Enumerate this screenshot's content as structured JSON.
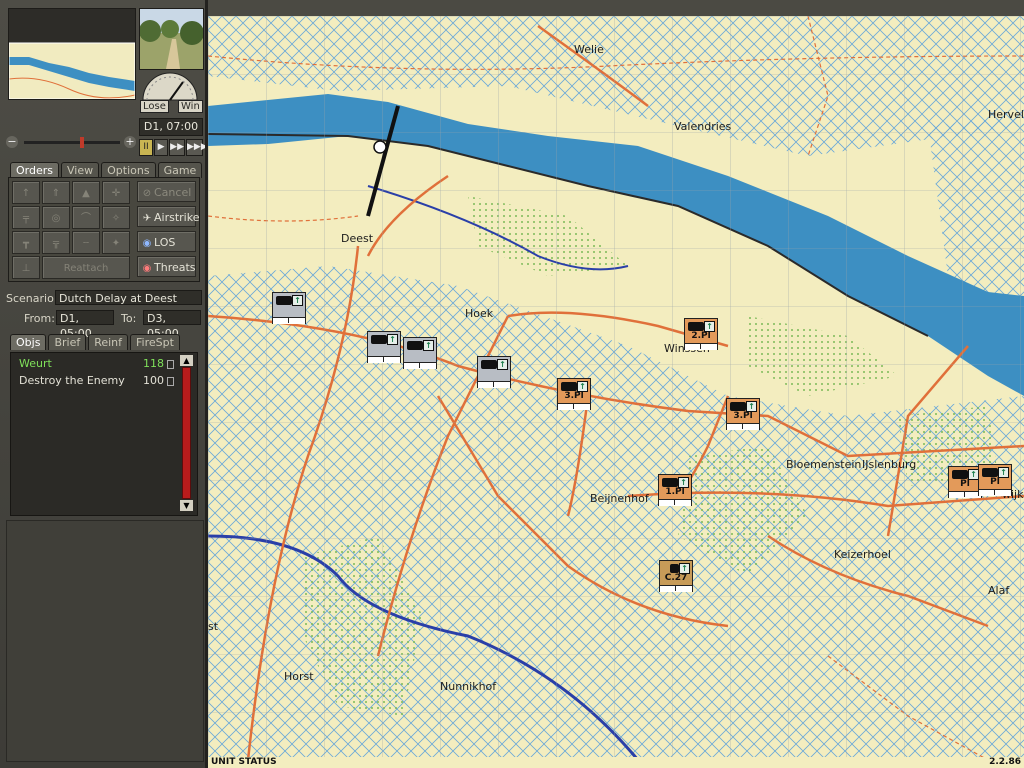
{
  "sidebar": {
    "gauge": {
      "lose_label": "Lose",
      "win_label": "Win"
    },
    "datetime": "D1, 07:00",
    "zoom": {
      "minus": "−",
      "plus": "+"
    },
    "playback": [
      "II",
      "▶",
      "▶▶",
      "▶▶▶"
    ],
    "main_tabs": [
      "Orders",
      "View",
      "Options",
      "Game"
    ],
    "orders": {
      "reattach_label": "Reattach",
      "cancel_label": "Cancel",
      "airstrike_label": "Airstrike",
      "los_label": "LOS",
      "threats_label": "Threats"
    },
    "scenario": {
      "label": "Scenario:",
      "name": "Dutch Delay at Deest",
      "from_label": "From:",
      "from_value": "D1, 05:00",
      "to_label": "To:",
      "to_value": "D3, 05:00"
    },
    "info_tabs": [
      "Objs",
      "Brief",
      "Reinf",
      "FireSpt"
    ],
    "objectives": [
      {
        "name": "Weurt",
        "value": "118"
      },
      {
        "name": "Destroy the Enemy",
        "value": "100"
      }
    ]
  },
  "map": {
    "places": [
      {
        "name": "Welie"
      },
      {
        "name": "Valendries"
      },
      {
        "name": "Herveld"
      },
      {
        "name": "Deest"
      },
      {
        "name": "Hoek"
      },
      {
        "name": "Winssen"
      },
      {
        "name": "Bloemenstein"
      },
      {
        "name": "IJslenburg"
      },
      {
        "name": "Beijnenhof"
      },
      {
        "name": "Keizerhoel"
      },
      {
        "name": "Alaf"
      },
      {
        "name": "Horst"
      },
      {
        "name": "Nunnikhof"
      },
      {
        "name": "st"
      },
      {
        "name": "wijk"
      }
    ],
    "units": [
      {
        "side": "enemy",
        "label": ""
      },
      {
        "side": "enemy",
        "label": ""
      },
      {
        "side": "enemy",
        "label": ""
      },
      {
        "side": "enemy",
        "label": ""
      },
      {
        "side": "allied",
        "label": "2.Pl"
      },
      {
        "side": "allied",
        "label": "3.Pl"
      },
      {
        "side": "allied",
        "label": "3.Pl"
      },
      {
        "side": "allied",
        "label": "1.Pl"
      },
      {
        "side": "allied",
        "label": "Pl"
      },
      {
        "side": "allied",
        "label": "Pl"
      },
      {
        "side": "brown",
        "label": "C.27"
      }
    ]
  },
  "status": {
    "left": "UNIT STATUS",
    "right": "2.2.86"
  },
  "colors": {
    "water": "#3d8fc2",
    "road": "#e0703a",
    "river_line": "#2a3fa8",
    "land": "#f3edbf",
    "forest": "#8fc26c"
  }
}
